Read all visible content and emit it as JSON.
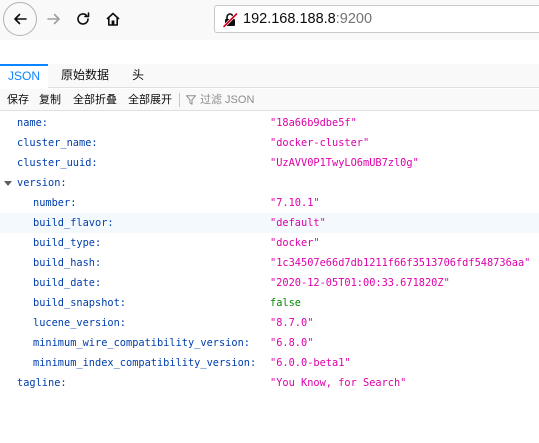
{
  "browser": {
    "url_host": "192.168.188.8",
    "url_port": ":9200"
  },
  "viewer": {
    "tabs": [
      "JSON",
      "原始数据",
      "头"
    ],
    "actions": {
      "save": "保存",
      "copy": "复制",
      "collapse_all": "全部折叠",
      "expand_all": "全部展开",
      "filter_placeholder": "过滤 JSON"
    }
  },
  "json": {
    "name": {
      "key": "name:",
      "value": "\"18a66b9dbe5f\""
    },
    "cluster_name": {
      "key": "cluster_name:",
      "value": "\"docker-cluster\""
    },
    "cluster_uuid": {
      "key": "cluster_uuid:",
      "value": "\"UzAVV0P1TwyLO6mUB7zl0g\""
    },
    "version": {
      "key": "version:",
      "number": {
        "key": "number:",
        "value": "\"7.10.1\""
      },
      "build_flavor": {
        "key": "build_flavor:",
        "value": "\"default\""
      },
      "build_type": {
        "key": "build_type:",
        "value": "\"docker\""
      },
      "build_hash": {
        "key": "build_hash:",
        "value": "\"1c34507e66d7db1211f66f3513706fdf548736aa\""
      },
      "build_date": {
        "key": "build_date:",
        "value": "\"2020-12-05T01:00:33.671820Z\""
      },
      "build_snapshot": {
        "key": "build_snapshot:",
        "value": "false"
      },
      "lucene_version": {
        "key": "lucene_version:",
        "value": "\"8.7.0\""
      },
      "minimum_wire_compatibility_version": {
        "key": "minimum_wire_compatibility_version:",
        "value": "\"6.8.0\""
      },
      "minimum_index_compatibility_version": {
        "key": "minimum_index_compatibility_version:",
        "value": "\"6.0.0-beta1\""
      }
    },
    "tagline": {
      "key": "tagline:",
      "value": "\"You Know, for Search\""
    }
  }
}
